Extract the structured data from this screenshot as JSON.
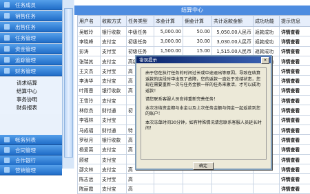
{
  "sidebar": {
    "menu": [
      {
        "label": "任务成员"
      },
      {
        "label": "销售任务"
      },
      {
        "label": "出售任务"
      },
      {
        "label": "任务管理"
      },
      {
        "label": "资金管理"
      },
      {
        "label": "追踪管理"
      },
      {
        "label": "财务管理"
      }
    ],
    "submenu": [
      "请求结算",
      "结算中心",
      "事务协明",
      "财务报表"
    ],
    "bottom": [
      {
        "label": "帐务列表"
      },
      {
        "label": "合同管理"
      },
      {
        "label": "合作银行"
      },
      {
        "label": "营销管理"
      }
    ]
  },
  "main": {
    "title": "结算中心",
    "columns": [
      "用户名",
      "收款方式",
      "任务类型",
      "本金计算",
      "佣金计算",
      "共计返款金额",
      "成功功能",
      "提示信息"
    ],
    "rows": [
      [
        "吴敏玲",
        "银行收款",
        "中级任务",
        "5,000.00",
        "50.00",
        "5,050.00人民币",
        "返款成功",
        "详情查看"
      ],
      [
        "李晓峰",
        "支付宝",
        "初级任务",
        "3,000.00",
        "30.00",
        "3,030.00人民币",
        "返款成功",
        "详情查看"
      ],
      [
        "彭涛",
        "支付宝",
        "初级任务",
        "1,500.00",
        "15.00",
        "1,515.00人民币",
        "返款成功",
        "详情查看"
      ],
      [
        "张瑞其",
        "支付宝",
        "高级任务",
        "2,500.00",
        "126.00",
        "2,646.00人民币",
        "返款成功",
        "详情查看"
      ],
      [
        "王文杰",
        "支付宝",
        "高",
        "",
        "",
        "",
        "",
        "详情查看"
      ],
      [
        "李涛华",
        "支付宝",
        "高",
        "",
        "",
        "",
        "",
        "详情查看"
      ],
      [
        "叶雨恩",
        "银行收款",
        "高",
        "",
        "",
        "",
        "",
        "详情查看"
      ],
      [
        "王雪玲",
        "支付宝",
        "",
        "",
        "",
        "",
        "",
        "详情查看"
      ],
      [
        "林欣杰",
        "财付通",
        "初",
        "",
        "",
        "",
        "",
        "详情查看"
      ],
      [
        "李福林",
        "支付宝",
        "",
        "",
        "",
        "",
        "",
        "详情查看"
      ],
      [
        "马成福",
        "财付通",
        "特",
        "",
        "",
        "",
        "",
        "详情查看"
      ],
      [
        "罗秋月",
        "银行收款",
        "高",
        "",
        "",
        "",
        "",
        "详情查看"
      ],
      [
        "杨爱英",
        "支付宝",
        "高",
        "",
        "",
        "",
        "",
        "详情查看"
      ],
      [
        "顾坡",
        "支付宝",
        "",
        "",
        "",
        "",
        "",
        "详情查看"
      ],
      [
        "邵文林",
        "支付宝",
        "高",
        "",
        "",
        "",
        "",
        "详情查看"
      ],
      [
        "陈志远",
        "支付宝",
        "高",
        "",
        "",
        "",
        "",
        "详情查看"
      ],
      [
        "陈丽霞",
        "支付宝",
        "高",
        "",
        "",
        "",
        "",
        "详情查看"
      ]
    ]
  },
  "dialog": {
    "title": "错误提示",
    "close": "×",
    "para1": "由于您在执行任务的时间过长或中途退出等原因，导致在结算返款的这段时中出现了故障，您的返款一直处于冻结状态，您现在需要重新一次与任务金额一样的任务来激活，才可以成功返款！",
    "para2": "请您联系客服人员安排重新完善任务！",
    "para3": "本次冻结资金都与本金以及上次任务金额与佣金一起返款到您的账户！",
    "para4": "本次冻单时间30分钟，如有特殊情况请您联系客服人员延长时间！",
    "ok": "确定"
  }
}
